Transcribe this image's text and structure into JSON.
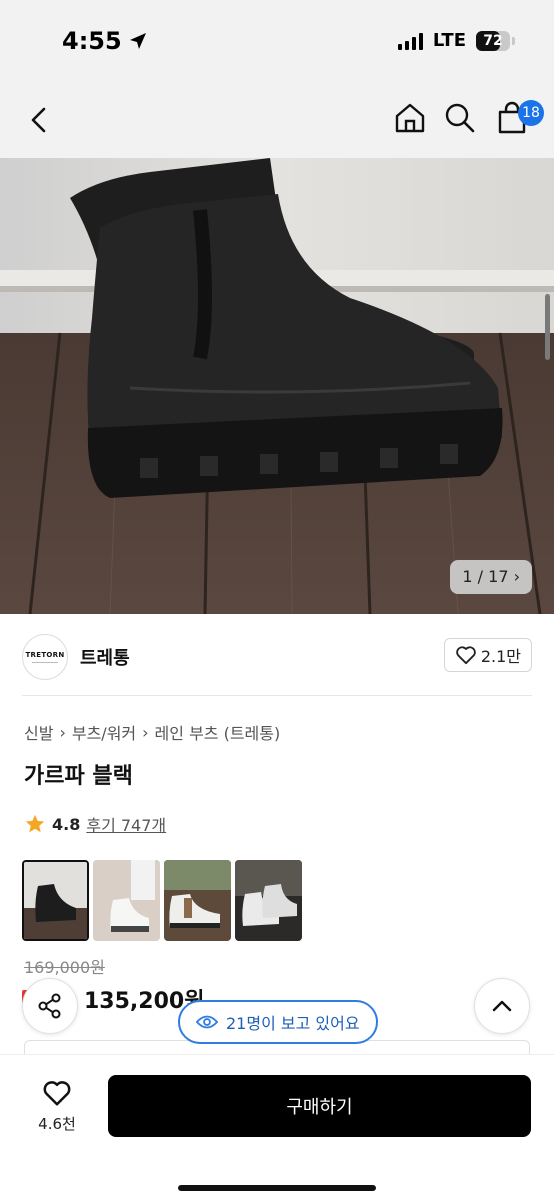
{
  "status_bar": {
    "time": "4:55",
    "network": "LTE",
    "battery_percent": "72",
    "battery_level": 0.72
  },
  "header": {
    "cart_count": "18",
    "icons": [
      "chevron-left-icon",
      "home-icon",
      "search-icon",
      "cart-icon"
    ]
  },
  "gallery": {
    "counter": "1 / 17 ›"
  },
  "brand": {
    "logo_text": "TRETORN",
    "name": "트레통",
    "likes": "2.1만"
  },
  "breadcrumb": {
    "items": [
      "신발",
      "부츠/워커",
      "레인 부츠 (트레통)"
    ],
    "separator": "›"
  },
  "product": {
    "title": "가르파 블랙",
    "rating": "4.8",
    "reviews": "후기 747개",
    "original_price": "169,000원",
    "sale_price": "135,200원"
  },
  "thumbnails": [
    {
      "label": "black-boot-thumb",
      "active": true
    },
    {
      "label": "white-boot-styled-thumb",
      "active": false
    },
    {
      "label": "white-boot-floor-thumb",
      "active": false
    },
    {
      "label": "white-boot-pair-thumb",
      "active": false
    }
  ],
  "viewers": {
    "text": "21명이 보고 있어요"
  },
  "bottom_bar": {
    "wish_count": "4.6천",
    "buy_label": "구매하기"
  },
  "colors": {
    "accent_blue": "#2f7de1",
    "badge_blue": "#1a73e8",
    "star": "#f5a623",
    "buy_button": "#000000"
  }
}
